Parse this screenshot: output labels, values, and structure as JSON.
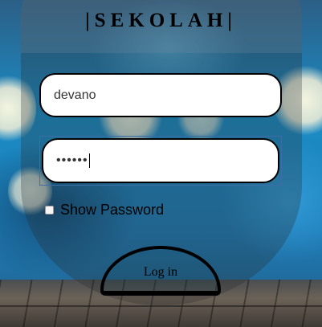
{
  "app": {
    "title": "|SEKOLAH|"
  },
  "login_form": {
    "username_value": "devano",
    "password_value": "••••••",
    "show_password_label": "Show Password",
    "show_password_checked": false,
    "login_button_label": "Log in"
  },
  "colors": {
    "field_border": "#000000",
    "field_background": "#ffffff",
    "focus_outline": "#3d6ea8",
    "background_blue": "#1a8cc5"
  }
}
